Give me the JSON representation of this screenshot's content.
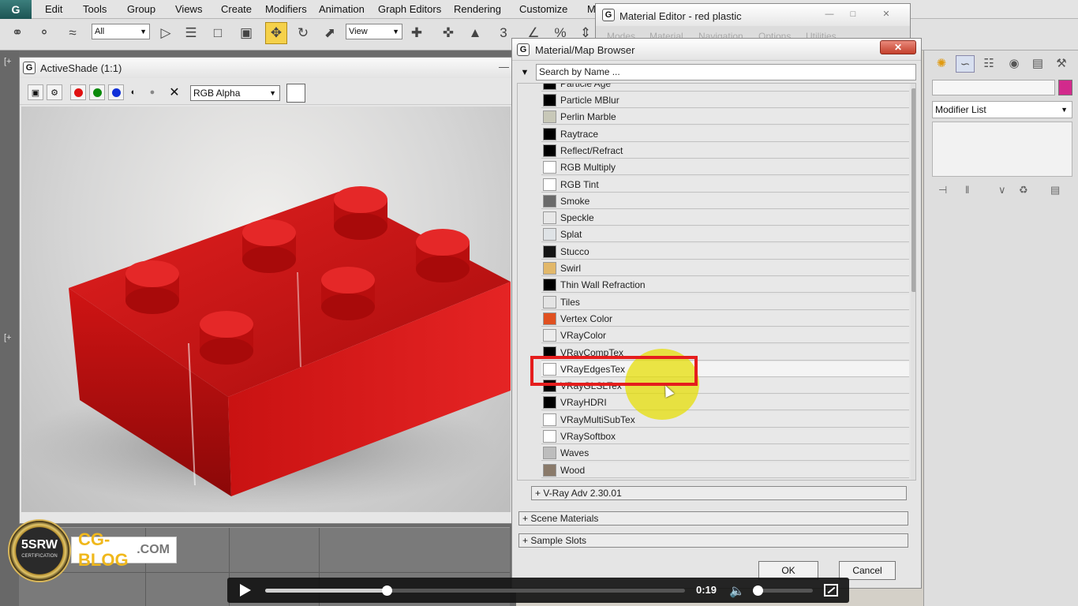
{
  "menubar": {
    "logo": "G",
    "items": [
      "Edit",
      "Tools",
      "Group",
      "Views",
      "Create",
      "Modifiers",
      "Animation",
      "Graph Editors",
      "Rendering",
      "Customize",
      "M"
    ]
  },
  "toolbar": {
    "selection_filter": "All",
    "reference_coord": "View",
    "snap_label": "3"
  },
  "activeshade": {
    "title": "ActiveShade (1:1)",
    "channel_select": "RGB Alpha",
    "channel_options": [
      "RGB Alpha"
    ],
    "colors": {
      "red": "#e01010",
      "green": "#0b8a0b",
      "blue": "#1030d8"
    }
  },
  "material_editor": {
    "title": "Material Editor - red plastic",
    "menus": [
      "Modes",
      "Material",
      "Navigation",
      "Options",
      "Utilities"
    ]
  },
  "browser": {
    "title": "Material/Map Browser",
    "search_placeholder": "Search by Name ...",
    "partial_top_item": "Particle Age",
    "items": [
      {
        "label": "Particle MBlur",
        "swatch": "#000000"
      },
      {
        "label": "Perlin Marble",
        "swatch": "#c8c8b8"
      },
      {
        "label": "Raytrace",
        "swatch": "#000000"
      },
      {
        "label": "Reflect/Refract",
        "swatch": "#000000"
      },
      {
        "label": "RGB Multiply",
        "swatch": "#ffffff"
      },
      {
        "label": "RGB Tint",
        "swatch": "#ffffff"
      },
      {
        "label": "Smoke",
        "swatch": "#6a6a6a"
      },
      {
        "label": "Speckle",
        "swatch": "#e8e8e8"
      },
      {
        "label": "Splat",
        "swatch": "#dfe3e6"
      },
      {
        "label": "Stucco",
        "swatch": "#141414"
      },
      {
        "label": "Swirl",
        "swatch": "#e2b86a"
      },
      {
        "label": "Thin Wall Refraction",
        "swatch": "#000000"
      },
      {
        "label": "Tiles",
        "swatch": "#e4e4e4"
      },
      {
        "label": "Vertex Color",
        "swatch": "#e05020"
      },
      {
        "label": "VRayColor",
        "swatch": "#ececec"
      },
      {
        "label": "VRayCompTex",
        "swatch": "#000000"
      },
      {
        "label": "VRayEdgesTex",
        "swatch": "#ffffff"
      },
      {
        "label": "VRayGLSLTex",
        "swatch": "#000000"
      },
      {
        "label": "VRayHDRI",
        "swatch": "#000000"
      },
      {
        "label": "VRayMultiSubTex",
        "swatch": "#ffffff"
      },
      {
        "label": "VRaySoftbox",
        "swatch": "#ffffff"
      },
      {
        "label": "Waves",
        "swatch": "#bdbdbd"
      },
      {
        "label": "Wood",
        "swatch": "#8a7a6a"
      }
    ],
    "highlighted_item": "VRayEdgesTex",
    "groups": [
      "+ V-Ray Adv 2.30.01",
      "+ Scene Materials",
      "+ Sample Slots"
    ],
    "ok_label": "OK",
    "cancel_label": "Cancel"
  },
  "command_panel": {
    "modifier_list": "Modifier List",
    "object_color": "#d22a8c"
  },
  "logo": {
    "badge_title": "5SRW",
    "badge_sub": "CERTIFICATION",
    "brand_cg": "CG-BLOG",
    "brand_com": ".COM"
  },
  "player": {
    "time": "0:19",
    "progress": 0.29,
    "volume": 0.0
  }
}
